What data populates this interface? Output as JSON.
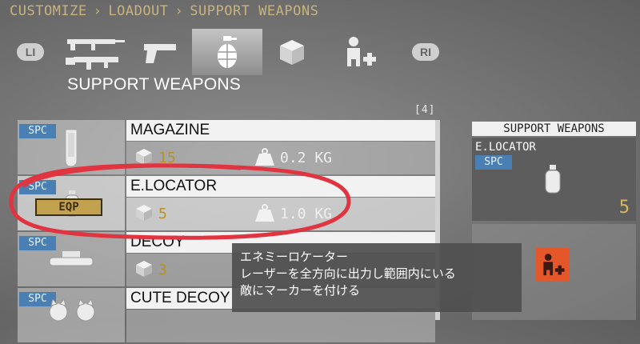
{
  "breadcrumb": {
    "items": [
      "CUSTOMIZE",
      "LOADOUT",
      "SUPPORT WEAPONS"
    ],
    "separator": "›"
  },
  "tabs": {
    "left_bumper": "LI",
    "right_bumper": "RI",
    "items": [
      {
        "icon": "rifle-icon",
        "active": false
      },
      {
        "icon": "pistol-icon",
        "active": false
      },
      {
        "icon": "grenade-icon",
        "active": true
      },
      {
        "icon": "box-icon",
        "active": false
      },
      {
        "icon": "buddy-plus-icon",
        "active": false
      }
    ]
  },
  "section_title": "SUPPORT WEAPONS",
  "count": "[4]",
  "items": [
    {
      "badge": "SPC",
      "name": "MAGAZINE",
      "ammo": "15",
      "weight": "0.2 KG",
      "equipped": false,
      "icon": "magazine-icon"
    },
    {
      "badge": "SPC",
      "name": "E.LOCATOR",
      "ammo": "5",
      "weight": "1.0 KG",
      "equipped": true,
      "equipped_label": "EQP",
      "icon": "e-locator-icon"
    },
    {
      "badge": "SPC",
      "name": "DECOY",
      "ammo": "3",
      "weight": "",
      "equipped": false,
      "icon": "decoy-icon"
    },
    {
      "badge": "SPC",
      "name": "CUTE DECOY",
      "ammo": "",
      "weight": "",
      "equipped": false,
      "icon": "cute-decoy-icon"
    }
  ],
  "side_panel": {
    "header": "SUPPORT WEAPONS",
    "item_name": "E.LOCATOR",
    "badge": "SPC",
    "count": "5"
  },
  "tooltip": {
    "title": "エネミーロケーター",
    "line1": "レーザーを全方向に出力し範囲内にいる",
    "line2": "敵にマーカーを付ける"
  },
  "colors": {
    "accent": "#c9b37c",
    "badge": "#4a7fb3",
    "ammo": "#b59228",
    "action": "#e4572a",
    "highlight": "#e03440"
  }
}
